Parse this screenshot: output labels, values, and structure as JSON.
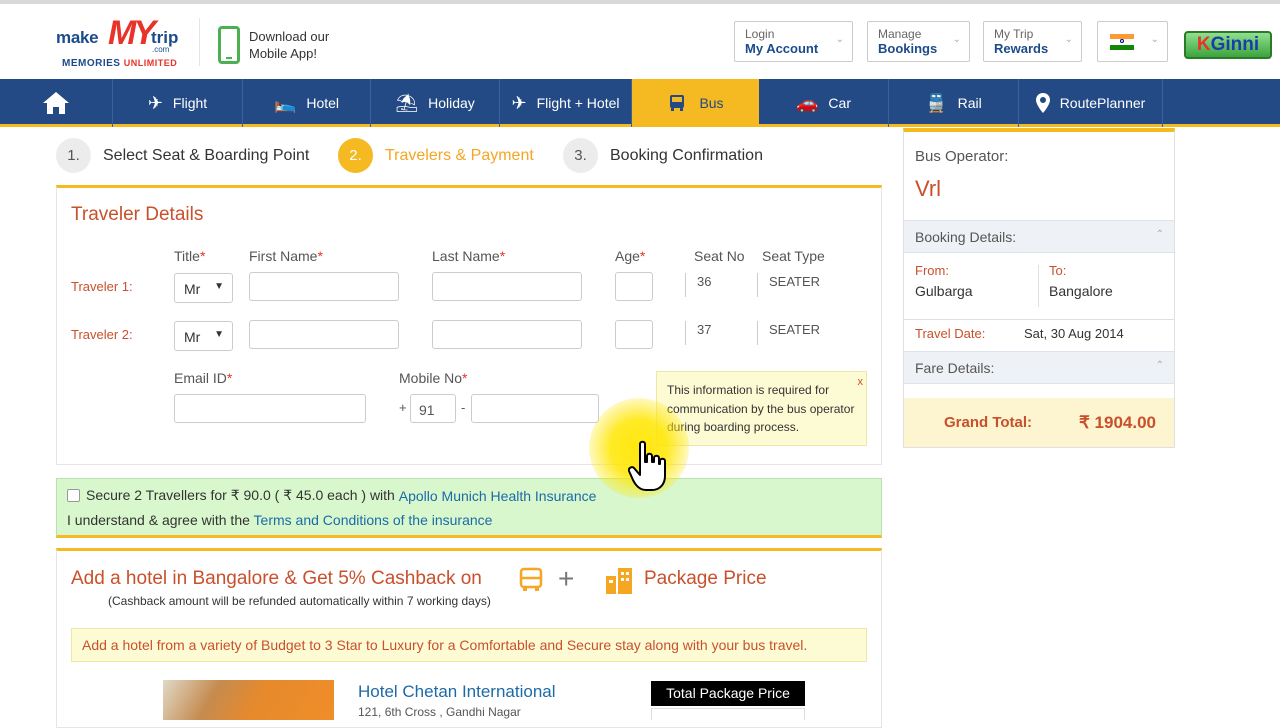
{
  "header": {
    "logo": {
      "make": "make",
      "my": "MY",
      "trip": "trip",
      "com": ".com",
      "tagline_1": "MEMORIES",
      "tagline_2": "UNLIMITED"
    },
    "app_promo": {
      "line1": "Download our",
      "line2": "Mobile App!"
    },
    "login": {
      "line1": "Login",
      "line2": "My Account"
    },
    "manage": {
      "line1": "Manage",
      "line2": "Bookings"
    },
    "rewards": {
      "line1": "My Trip",
      "line2": "Rewards"
    },
    "badge": {
      "k": "K",
      "rest": "Ginni"
    },
    "colors": {
      "brand_blue": "#234a85",
      "accent": "#f5b921",
      "red": "#e8322a"
    }
  },
  "nav": [
    {
      "icon": "home-icon",
      "label": ""
    },
    {
      "icon": "flight-icon",
      "label": "Flight"
    },
    {
      "icon": "hotel-icon",
      "label": "Hotel"
    },
    {
      "icon": "holiday-icon",
      "label": "Holiday"
    },
    {
      "icon": "flight-hotel-icon",
      "label": "Flight + Hotel"
    },
    {
      "icon": "bus-icon",
      "label": "Bus",
      "active": true
    },
    {
      "icon": "car-icon",
      "label": "Car"
    },
    {
      "icon": "rail-icon",
      "label": "Rail"
    },
    {
      "icon": "location-pin-icon",
      "label": "RoutePlanner"
    }
  ],
  "steps": [
    {
      "num": "1.",
      "label": "Select Seat & Boarding Point"
    },
    {
      "num": "2.",
      "label": "Travelers & Payment",
      "active": true
    },
    {
      "num": "3.",
      "label": "Booking Confirmation"
    }
  ],
  "traveler_details": {
    "title": "Traveler Details",
    "columns": {
      "title": "Title",
      "first_name": "First Name",
      "last_name": "Last Name",
      "age": "Age",
      "seat_no": "Seat No",
      "seat_type": "Seat Type",
      "required_mark": "*"
    },
    "travelers": [
      {
        "label": "Traveler 1:",
        "title": "Mr",
        "seat_no": "36",
        "seat_type": "SEATER"
      },
      {
        "label": "Traveler 2:",
        "title": "Mr",
        "seat_no": "37",
        "seat_type": "SEATER"
      }
    ],
    "email_label": "Email ID",
    "mobile_label": "Mobile No",
    "mobile_prefix_plus": "+",
    "mobile_country_code": "91",
    "mobile_dash": "-",
    "tooltip": {
      "text": "This information is required for communication by the bus operator during boarding process.",
      "close": "x"
    }
  },
  "insurance": {
    "line1_prefix": "Secure 2 Travellers for ₹ 90.0 ( ₹ 45.0 each ) with ",
    "line1_link": "Apollo Munich Health Insurance",
    "line2_prefix": "I understand & agree with the ",
    "line2_link": "Terms and Conditions of the insurance"
  },
  "hotel_offer": {
    "title": "Add a hotel in Bangalore & Get 5% Cashback on",
    "plus": "+",
    "package": "Package Price",
    "subtitle": "(Cashback amount will be refunded automatically within 7 working days)",
    "banner": "Add a hotel from a variety of Budget to 3 Star to Luxury for a Comfortable and Secure stay along with your bus travel.",
    "hotel_name": "Hotel Chetan International",
    "hotel_address": "121, 6th Cross , Gandhi Nagar",
    "total_label": "Total Package Price"
  },
  "summary": {
    "operator_label": "Bus Operator:",
    "operator": "Vrl",
    "booking_details": "Booking Details:",
    "from_label": "From:",
    "from": "Gulbarga",
    "to_label": "To:",
    "to": "Bangalore",
    "date_label": "Travel Date:",
    "date": "Sat, 30 Aug 2014",
    "fare_details": "Fare Details:",
    "grand_label": "Grand Total:",
    "grand_value": "₹ 1904.00"
  }
}
